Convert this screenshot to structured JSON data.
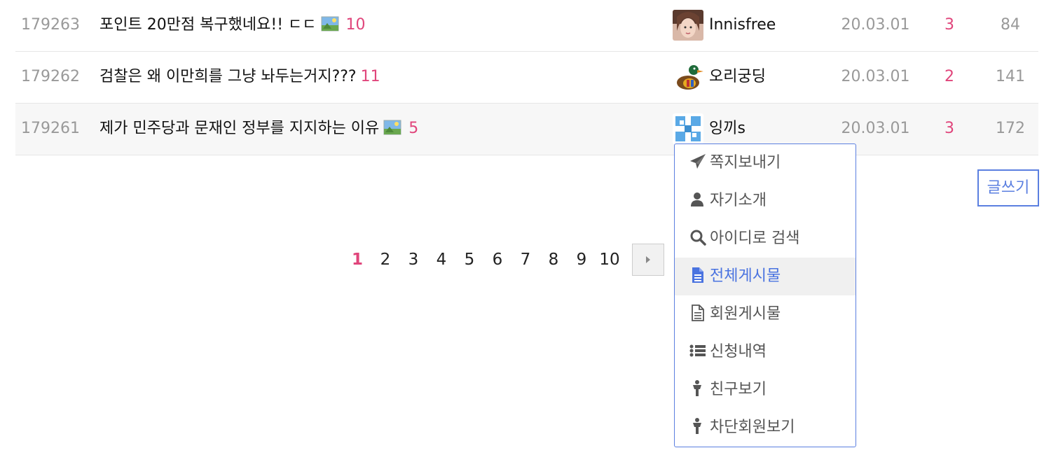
{
  "posts": [
    {
      "num": "179263",
      "title": "포인트 20만점 복구했네요!! ㄷㄷ",
      "has_image": true,
      "comments": "10",
      "author": "Innisfree",
      "avatar_icon": "person-photo-avatar",
      "date": "20.03.01",
      "recommend": "3",
      "views": "84"
    },
    {
      "num": "179262",
      "title": "검찰은 왜 이만희를 그냥 놔두는거지???",
      "has_image": false,
      "comments": "11",
      "author": "오리궁딩",
      "avatar_icon": "duck-avatar",
      "date": "20.03.01",
      "recommend": "2",
      "views": "141"
    },
    {
      "num": "179261",
      "title": "제가 민주당과 문재인 정부를 지지하는 이유",
      "has_image": true,
      "comments": "5",
      "author": "잉끼s",
      "avatar_icon": "blue-pattern-avatar",
      "date": "20.03.01",
      "recommend": "3",
      "views": "172"
    }
  ],
  "write_button": "글쓰기",
  "pagination": {
    "pages": [
      "1",
      "2",
      "3",
      "4",
      "5",
      "6",
      "7",
      "8",
      "9",
      "10"
    ],
    "current": "1"
  },
  "user_menu": {
    "items": [
      {
        "label": "쪽지보내기",
        "icon": "paper-plane-icon"
      },
      {
        "label": "자기소개",
        "icon": "user-icon"
      },
      {
        "label": "아이디로 검색",
        "icon": "search-icon"
      },
      {
        "label": "전체게시물",
        "icon": "document-icon",
        "active": true
      },
      {
        "label": "회원게시물",
        "icon": "document-outline-icon"
      },
      {
        "label": "신청내역",
        "icon": "list-icon"
      },
      {
        "label": "친구보기",
        "icon": "person-icon"
      },
      {
        "label": "차단회원보기",
        "icon": "person-icon"
      }
    ]
  },
  "colors": {
    "accent_pink": "#e0457b",
    "accent_blue": "#5b7fe0",
    "muted": "#999999"
  }
}
